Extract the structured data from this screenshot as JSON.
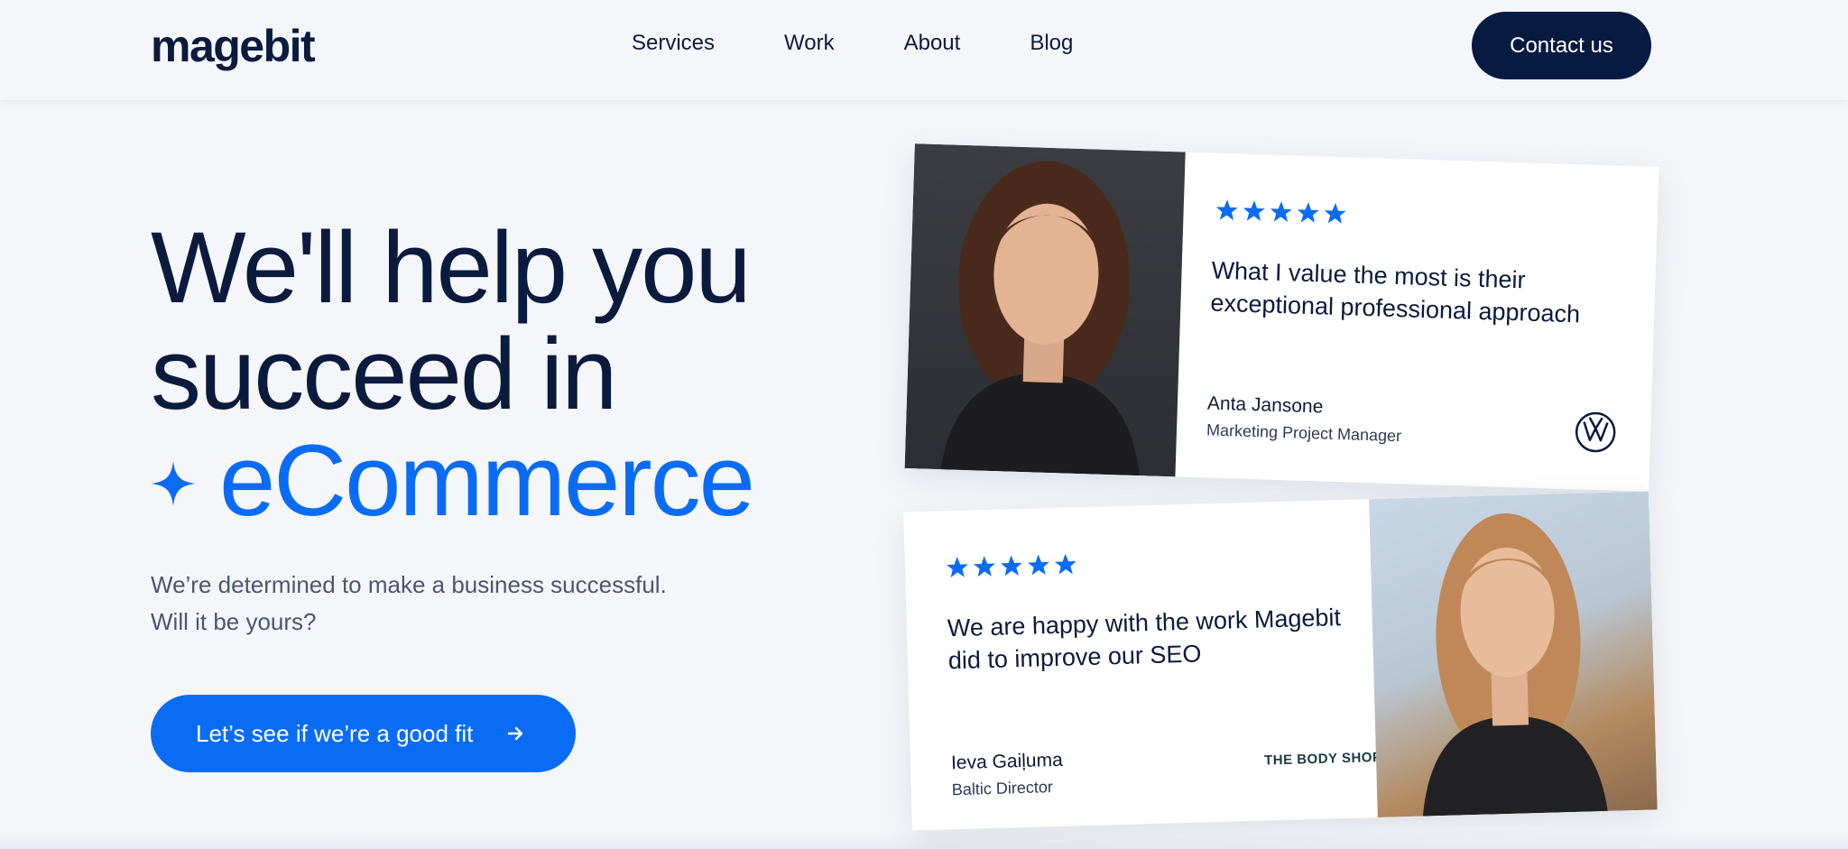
{
  "header": {
    "logo": "magebit",
    "nav": [
      {
        "label": "Services"
      },
      {
        "label": "Work"
      },
      {
        "label": "About"
      },
      {
        "label": "Blog"
      }
    ],
    "contact_label": "Contact us"
  },
  "hero": {
    "title_line1": "We'll help you",
    "title_line2": "succeed in",
    "title_line3": "eCommerce",
    "subtitle_line1": "We’re determined to make a business successful.",
    "subtitle_line2": "Will it be yours?",
    "cta_label": "Let’s see if we’re a good fit"
  },
  "testimonials": [
    {
      "rating": 5,
      "quote": "What I value the most is their exceptional professional approach",
      "name": "Anta Jansone",
      "role": "Marketing Project Manager",
      "company_logo": "volkswagen-logo-icon"
    },
    {
      "rating": 5,
      "quote": "We are happy with the work Magebit did to improve our SEO",
      "name": "Ieva Gaiļuma",
      "role": "Baltic Director",
      "company": "THE BODY SHOP"
    }
  ],
  "colors": {
    "navy": "#0b1b3d",
    "contact_button": "#071a40",
    "accent_blue": "#0a6cf5",
    "background": "#f5f6fa"
  }
}
